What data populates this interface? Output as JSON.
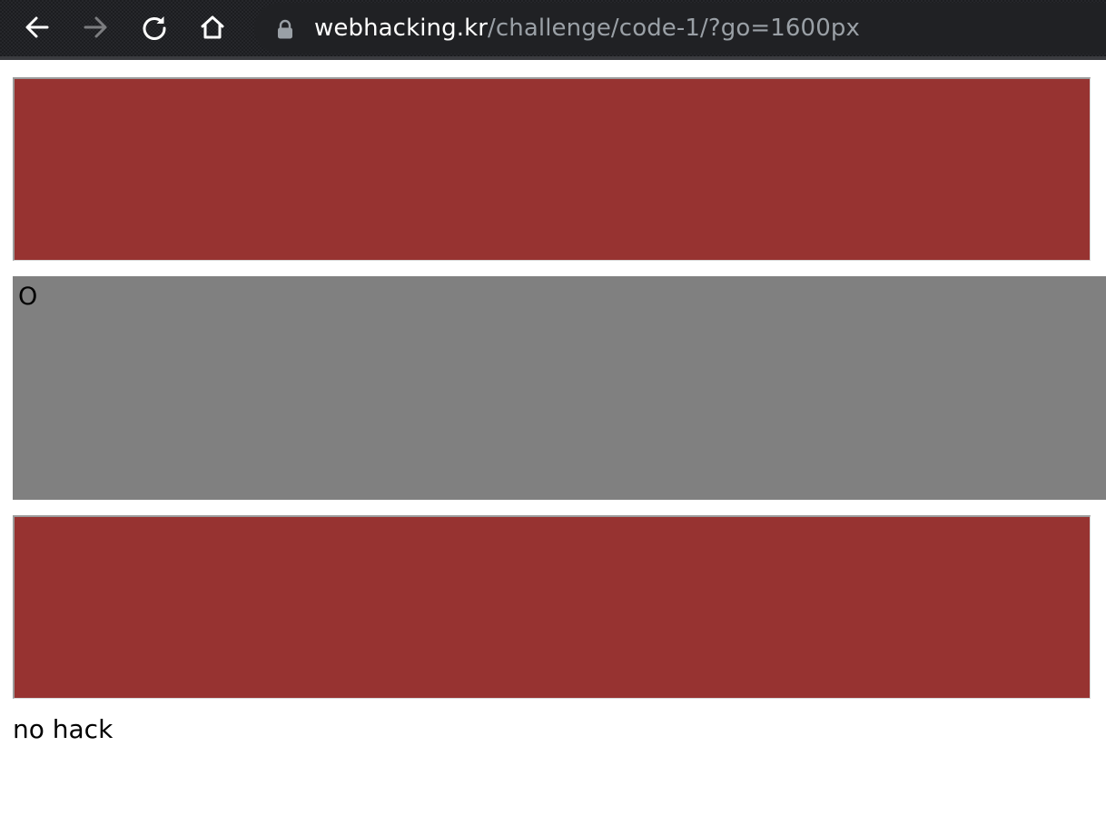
{
  "browser": {
    "back_icon": "arrow-left-icon",
    "forward_icon": "arrow-right-icon",
    "reload_icon": "reload-icon",
    "home_icon": "home-icon",
    "lock_icon": "lock-icon",
    "url_host": "webhacking.kr",
    "url_path": "/challenge/code-1/?go=1600px"
  },
  "page": {
    "marker_text": "O",
    "message": "no hack"
  },
  "colors": {
    "panel": "#973331",
    "bar": "#808080",
    "toolbar": "#1c1d20",
    "omnibox": "#202124"
  }
}
